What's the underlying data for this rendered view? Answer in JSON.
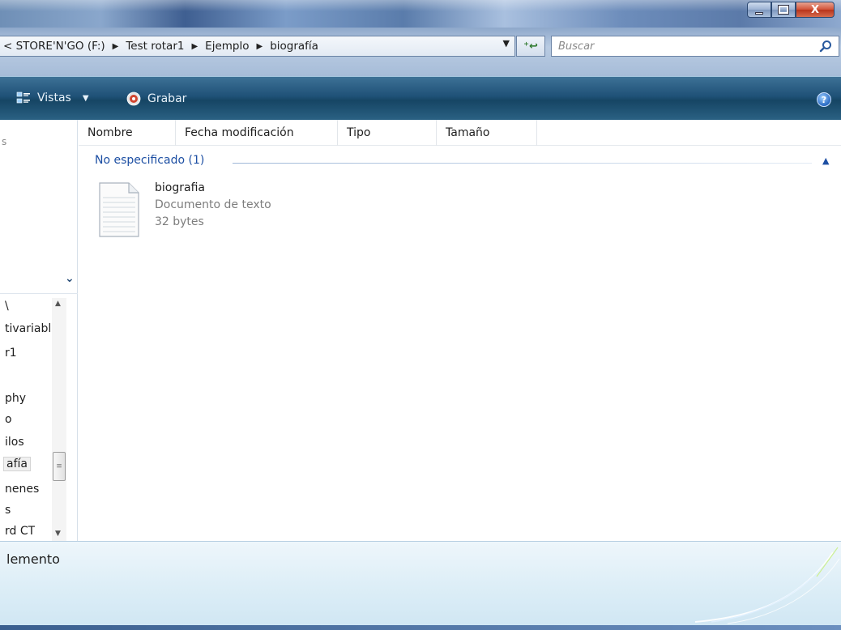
{
  "window": {
    "close_glyph": "X"
  },
  "address": {
    "crumbs": [
      "< STORE'N'GO (F:)",
      "Test rotar1",
      "Ejemplo",
      "biografía"
    ],
    "search_placeholder": "Buscar"
  },
  "toolbar": {
    "vistas_label": "Vistas",
    "grabar_label": "Grabar",
    "help_glyph": "?"
  },
  "navpane": {
    "top_fragment": "s",
    "folder_fragments": [
      "\\",
      "tivariabl",
      "r1",
      "phy",
      "o",
      "ilos",
      "afía",
      "nenes",
      "s",
      "rd CT"
    ],
    "selected_index": 6
  },
  "columns": [
    "Nombre",
    "Fecha modificación",
    "Tipo",
    "Tamaño"
  ],
  "group": {
    "label": "No especificado (1)"
  },
  "file": {
    "name": "biografia",
    "type": "Documento de texto",
    "size": "32 bytes"
  },
  "details": {
    "text": "lemento"
  },
  "colors": {
    "group_label": "#1d4fa3",
    "toolbar": "#1f5177",
    "details_pane": "#ddeef7"
  },
  "icons": [
    "views-icon",
    "dropdown-arrow-icon",
    "burn-icon",
    "help-icon",
    "search-icon",
    "refresh-icon",
    "text-file-icon"
  ]
}
